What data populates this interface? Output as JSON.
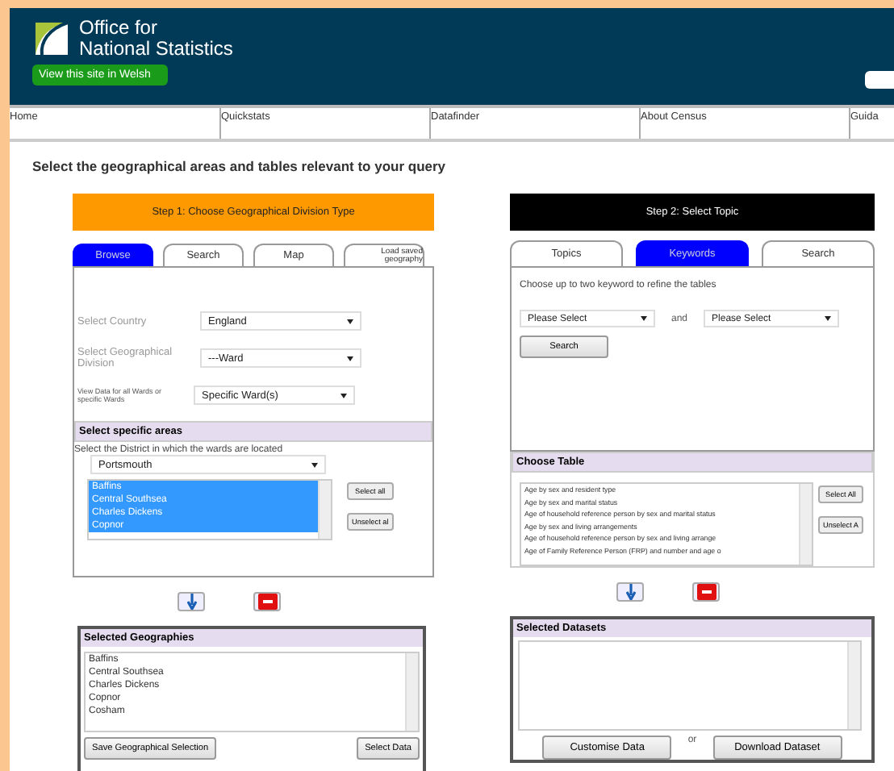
{
  "header": {
    "logo_lines": [
      "Office for",
      "National Statistics"
    ],
    "welsh_button": "View this site in Welsh"
  },
  "nav": [
    "Home",
    "Quickstats",
    "Datafinder",
    "About Census",
    "Guida"
  ],
  "heading": "Select the geographical areas and tables relevant to your query",
  "step1": {
    "title": "Step 1: Choose Geographical Division Type",
    "tabs": [
      {
        "label": "Browse",
        "selected": true
      },
      {
        "label": "Search",
        "selected": false
      },
      {
        "label": "Map",
        "selected": false
      },
      {
        "label": "Load saved geography",
        "selected": false
      }
    ],
    "fields": [
      {
        "label": "Select Country",
        "value": "England",
        "small": false
      },
      {
        "label": "Select Geographical Division",
        "value": "---Ward",
        "small": false
      },
      {
        "label": "View Data for all Wards or specific Wards",
        "value": "Specific Ward(s)",
        "small": true
      }
    ],
    "areas": {
      "title": "Select specific areas",
      "hint": "Select the District in which the wards are located",
      "district": "Portsmouth",
      "items": [
        {
          "label": "Baffins",
          "selected": true
        },
        {
          "label": "Central Southsea",
          "selected": true
        },
        {
          "label": "Charles Dickens",
          "selected": true
        },
        {
          "label": "Copnor",
          "selected": true
        }
      ],
      "buttons": [
        "Select all",
        "Unselect al"
      ]
    },
    "selected": {
      "title": "Selected Geographies",
      "items": [
        "Baffins",
        "Central Southsea",
        "Charles Dickens",
        "Copnor",
        "Cosham"
      ],
      "buttons": [
        "Save Geographical Selection",
        "Select Data"
      ]
    }
  },
  "step2": {
    "title": "Step 2: Select Topic",
    "tabs": [
      {
        "label": "Topics",
        "selected": false
      },
      {
        "label": "Keywords",
        "selected": true
      },
      {
        "label": "Search",
        "selected": false
      }
    ],
    "hint": "Choose up to two keyword to refine the tables",
    "keyword1": "Please Select",
    "joiner": "and",
    "keyword2": "Please Select",
    "search_button": "Search",
    "table": {
      "title": "Choose Table",
      "items": [
        "Age by sex and resident type",
        "Age by sex and marital status",
        "Age of household reference person by sex and marital status",
        "Age by sex and living arrangements",
        "Age of household reference person by sex and living arrange",
        "Age of Family Reference Person (FRP) and number and age o"
      ],
      "buttons": [
        "Select All",
        "Unselect A"
      ]
    },
    "datasets": {
      "title": "Selected Datasets",
      "customise": "Customise Data",
      "or": "or",
      "download": "Download Dataset"
    }
  }
}
